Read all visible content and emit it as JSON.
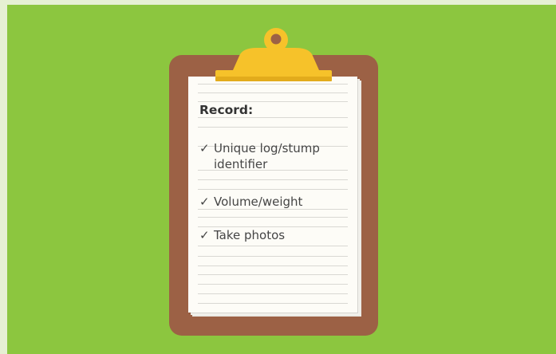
{
  "checklist": {
    "title": "Record:",
    "check_icon": "✓",
    "items": [
      {
        "label": "Unique log/stump identifier"
      },
      {
        "label": "Volume/weight"
      },
      {
        "label": "Take photos"
      }
    ]
  },
  "colors": {
    "background": "#8cc63f",
    "board": "#9c6145",
    "clip": "#f6c22a",
    "paper": "#fdfcf7"
  }
}
